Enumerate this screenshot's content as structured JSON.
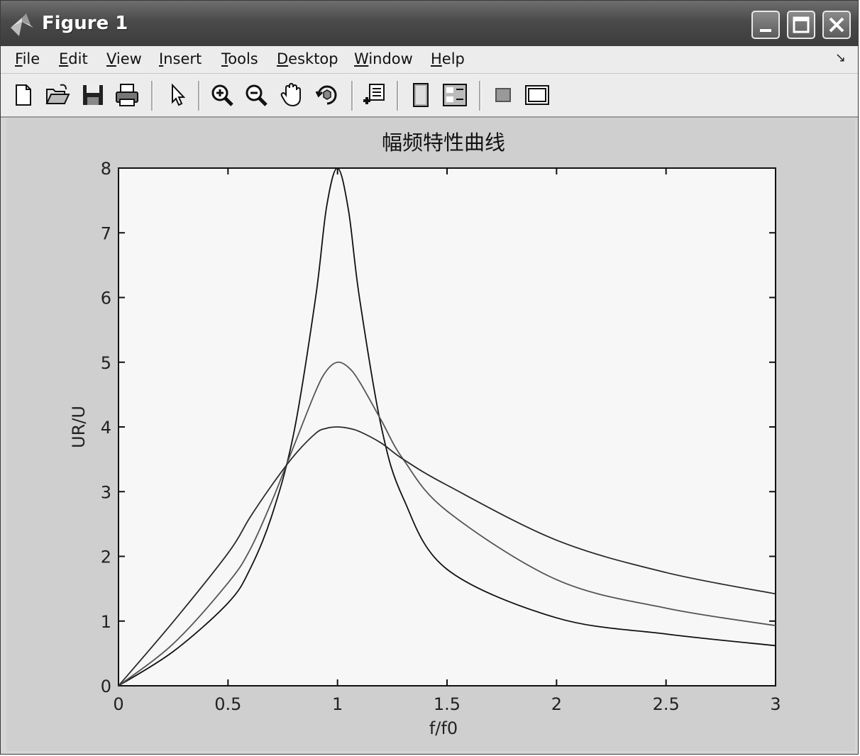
{
  "window": {
    "title": "Figure 1",
    "controls": [
      "minimize",
      "maximize",
      "close"
    ]
  },
  "menu": {
    "items": [
      "File",
      "Edit",
      "View",
      "Insert",
      "Tools",
      "Desktop",
      "Window",
      "Help"
    ],
    "dock_glyph": "↘"
  },
  "toolbar": {
    "icons": [
      "new-figure-icon",
      "open-file-icon",
      "save-icon",
      "print-icon",
      "edit-plot-arrow-icon",
      "zoom-in-icon",
      "zoom-out-icon",
      "pan-hand-icon",
      "rotate-3d-icon",
      "insert-legend-icon",
      "hide-plot-tools-icon",
      "show-plot-tools-icon",
      "insert-colorbar-icon",
      "plot-browser-icon"
    ]
  },
  "colors": {
    "titlebar": "#4a4a4a",
    "figure_bg": "#cfcfcf",
    "axes_bg": "#f7f7f7",
    "curve_sharp": "#111111",
    "curve_mid": "#555555",
    "curve_broad": "#2a2a2a"
  },
  "chart_data": {
    "type": "line",
    "title": "幅频特性曲线",
    "xlabel": "f/f0",
    "ylabel": "UR/U",
    "xlim": [
      0,
      3
    ],
    "ylim": [
      0,
      8
    ],
    "xticks": [
      "0",
      "0.5",
      "1",
      "1.5",
      "2",
      "2.5",
      "3"
    ],
    "yticks": [
      "0",
      "1",
      "2",
      "3",
      "4",
      "5",
      "6",
      "7",
      "8"
    ],
    "grid": false,
    "legend": "none",
    "series": [
      {
        "x": [
          0,
          0.25,
          0.5,
          0.6,
          0.7,
          0.8,
          0.9,
          0.95,
          1.0,
          1.05,
          1.1,
          1.2,
          1.3,
          1.5,
          2.0,
          2.5,
          3.0
        ],
        "y": [
          0,
          0.53,
          1.28,
          1.8,
          2.63,
          3.9,
          6.0,
          7.4,
          8.0,
          7.35,
          6.0,
          4.0,
          2.9,
          1.8,
          1.05,
          0.8,
          0.62
        ]
      },
      {
        "x": [
          0,
          0.25,
          0.5,
          0.6,
          0.7,
          0.8,
          0.9,
          0.95,
          1.0,
          1.05,
          1.1,
          1.2,
          1.3,
          1.5,
          2.0,
          2.5,
          3.0
        ],
        "y": [
          0,
          0.65,
          1.59,
          2.1,
          2.85,
          3.7,
          4.55,
          4.87,
          5.0,
          4.92,
          4.7,
          4.1,
          3.5,
          2.7,
          1.64,
          1.2,
          0.93
        ]
      },
      {
        "x": [
          0,
          0.25,
          0.5,
          0.6,
          0.7,
          0.8,
          0.9,
          0.95,
          1.0,
          1.05,
          1.1,
          1.2,
          1.3,
          1.5,
          2.0,
          2.5,
          3.0
        ],
        "y": [
          0,
          0.99,
          2.05,
          2.6,
          3.1,
          3.55,
          3.9,
          3.98,
          4.0,
          3.98,
          3.93,
          3.75,
          3.5,
          3.1,
          2.25,
          1.75,
          1.42
        ]
      }
    ]
  }
}
